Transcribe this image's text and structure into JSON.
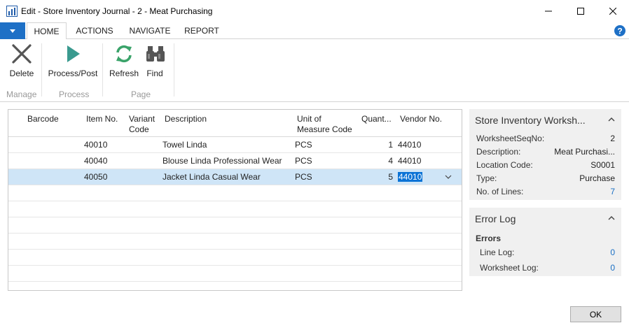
{
  "window": {
    "title": "Edit - Store Inventory Journal - 2 - Meat Purchasing",
    "icon": "app-chart-icon"
  },
  "ribbon": {
    "tabs": [
      {
        "label": "HOME",
        "active": true
      },
      {
        "label": "ACTIONS",
        "active": false
      },
      {
        "label": "NAVIGATE",
        "active": false
      },
      {
        "label": "REPORT",
        "active": false
      }
    ],
    "groups": {
      "manage": "Manage",
      "process": "Process",
      "page": "Page"
    },
    "buttons": {
      "delete": "Delete",
      "process_post": "Process/Post",
      "refresh": "Refresh",
      "find": "Find"
    }
  },
  "grid": {
    "columns": {
      "barcode": "Barcode",
      "item_no": "Item No.",
      "variant_code_1": "Variant",
      "variant_code_2": "Code",
      "description": "Description",
      "uom_1": "Unit of",
      "uom_2": "Measure Code",
      "quantity": "Quant...",
      "vendor_no": "Vendor No."
    },
    "rows": [
      {
        "barcode": "",
        "item_no": "40010",
        "variant_code": "",
        "description": "Towel Linda",
        "uom": "PCS",
        "quantity": "1",
        "vendor_no": "44010"
      },
      {
        "barcode": "",
        "item_no": "40040",
        "variant_code": "",
        "description": "Blouse Linda Professional Wear",
        "uom": "PCS",
        "quantity": "4",
        "vendor_no": "44010"
      },
      {
        "barcode": "",
        "item_no": "40050",
        "variant_code": "",
        "description": "Jacket Linda Casual Wear",
        "uom": "PCS",
        "quantity": "5",
        "vendor_no": "44010"
      }
    ],
    "selected_row": 2
  },
  "factbox_worksheet": {
    "title": "Store Inventory Worksh...",
    "fields": [
      {
        "label": "WorksheetSeqNo:",
        "value": "2",
        "link": false
      },
      {
        "label": "Description:",
        "value": "Meat Purchasi...",
        "link": false
      },
      {
        "label": "Location Code:",
        "value": "S0001",
        "link": false
      },
      {
        "label": "Type:",
        "value": "Purchase",
        "link": false
      },
      {
        "label": "No. of Lines:",
        "value": "7",
        "link": true
      }
    ]
  },
  "factbox_errors": {
    "title": "Error Log",
    "section": "Errors",
    "fields": [
      {
        "label": "Line Log:",
        "value": "0",
        "link": true
      },
      {
        "label": "Worksheet Log:",
        "value": "0",
        "link": true
      }
    ]
  },
  "footer": {
    "ok_label": "OK"
  },
  "colors": {
    "accent": "#1e70c6",
    "selected_row": "#cfe5f7",
    "panel_bg": "#f0f0f0",
    "link": "#1a6fc4",
    "post_icon": "#3a9a8f",
    "refresh_icon": "#3aa36a"
  }
}
